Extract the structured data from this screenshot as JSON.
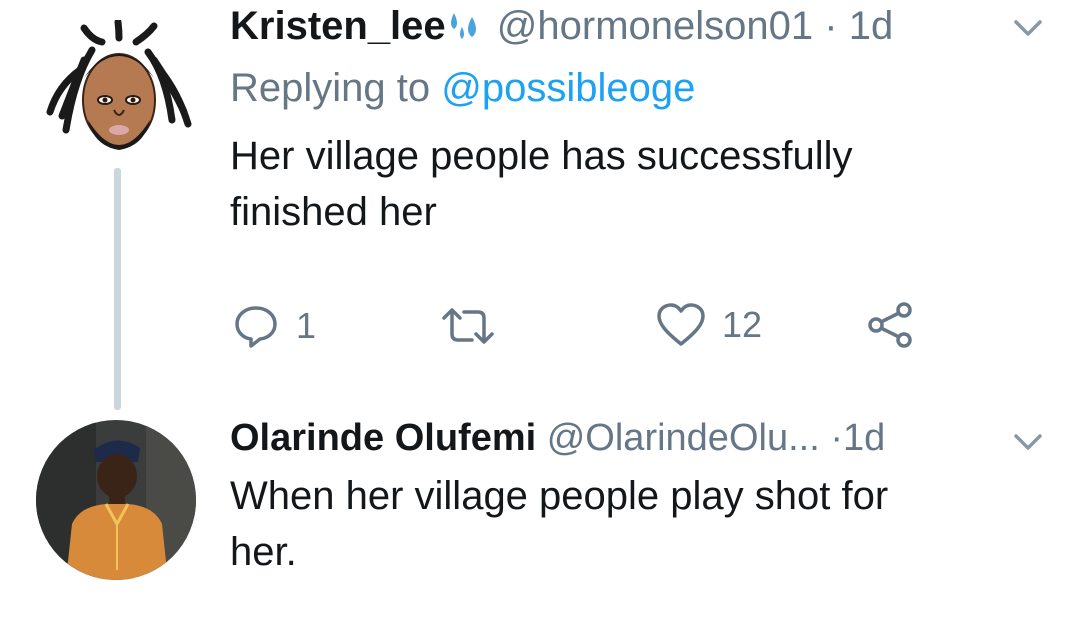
{
  "tweets": [
    {
      "name": "Kristen_lee",
      "name_emoji_icon": "sweat-droplets-icon",
      "handle": "@hormonelson01",
      "dot": "·",
      "time": "1d",
      "reply_prefix": "Replying to",
      "reply_mention": "@possibleoge",
      "body_line1": "Her village people has successfully",
      "body_line2": "finished her",
      "actions": {
        "reply_count": "1",
        "retweet_count": "",
        "like_count": "12"
      }
    },
    {
      "name": "Olarinde Olufemi",
      "handle": "@OlarindeOlu...",
      "dot": "·",
      "time": "1d",
      "body_line1": "When her village people play shot for",
      "body_line2": "her."
    }
  ],
  "colors": {
    "text": "#14171a",
    "muted": "#657786",
    "link": "#1da1f2",
    "thread_line": "#ccd6dd"
  }
}
